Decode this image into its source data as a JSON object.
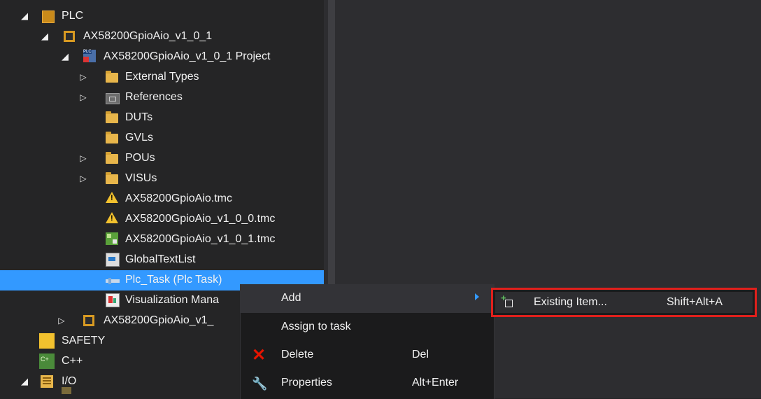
{
  "tree": {
    "items": [
      {
        "label": "PLC",
        "arrow": "expanded",
        "icon": "plc-icon"
      },
      {
        "label": "AX58200GpioAio_v1_0_1",
        "arrow": "expanded",
        "icon": "plc-project-icon"
      },
      {
        "label": "AX58200GpioAio_v1_0_1 Project",
        "arrow": "expanded",
        "icon": "project-file-icon"
      },
      {
        "label": "External Types",
        "arrow": "collapsed",
        "icon": "folder-icon"
      },
      {
        "label": "References",
        "arrow": "collapsed",
        "icon": "references-icon"
      },
      {
        "label": "DUTs",
        "arrow": "none",
        "icon": "folder-icon"
      },
      {
        "label": "GVLs",
        "arrow": "none",
        "icon": "folder-icon"
      },
      {
        "label": "POUs",
        "arrow": "collapsed",
        "icon": "folder-icon"
      },
      {
        "label": "VISUs",
        "arrow": "collapsed",
        "icon": "folder-icon"
      },
      {
        "label": "AX58200GpioAio.tmc",
        "arrow": "none",
        "icon": "warning-icon"
      },
      {
        "label": "AX58200GpioAio_v1_0_0.tmc",
        "arrow": "none",
        "icon": "warning-icon"
      },
      {
        "label": "AX58200GpioAio_v1_0_1.tmc",
        "arrow": "none",
        "icon": "tmc-icon"
      },
      {
        "label": "GlobalTextList",
        "arrow": "none",
        "icon": "text-list-icon"
      },
      {
        "label": "Plc_Task (Plc Task)",
        "arrow": "none",
        "icon": "task-icon",
        "selected": true
      },
      {
        "label": "Visualization Mana",
        "arrow": "none",
        "icon": "visualization-icon"
      },
      {
        "label": "AX58200GpioAio_v1_",
        "arrow": "collapsed",
        "icon": "plc-project-icon"
      },
      {
        "label": "SAFETY",
        "arrow": "none",
        "icon": "safety-icon"
      },
      {
        "label": "C++",
        "arrow": "none",
        "icon": "cpp-icon"
      },
      {
        "label": "I/O",
        "arrow": "expanded",
        "icon": "io-icon"
      }
    ]
  },
  "context_menu": {
    "add_label": "Add",
    "assign_label": "Assign to task",
    "delete_label": "Delete",
    "delete_shortcut": "Del",
    "properties_label": "Properties",
    "properties_shortcut": "Alt+Enter"
  },
  "submenu": {
    "existing_item_label": "Existing Item...",
    "existing_item_shortcut": "Shift+Alt+A",
    "highlight_color": "#e0201c"
  },
  "colors": {
    "selection": "#3399ff",
    "background": "#252526",
    "menu_background": "#1b1b1c"
  }
}
